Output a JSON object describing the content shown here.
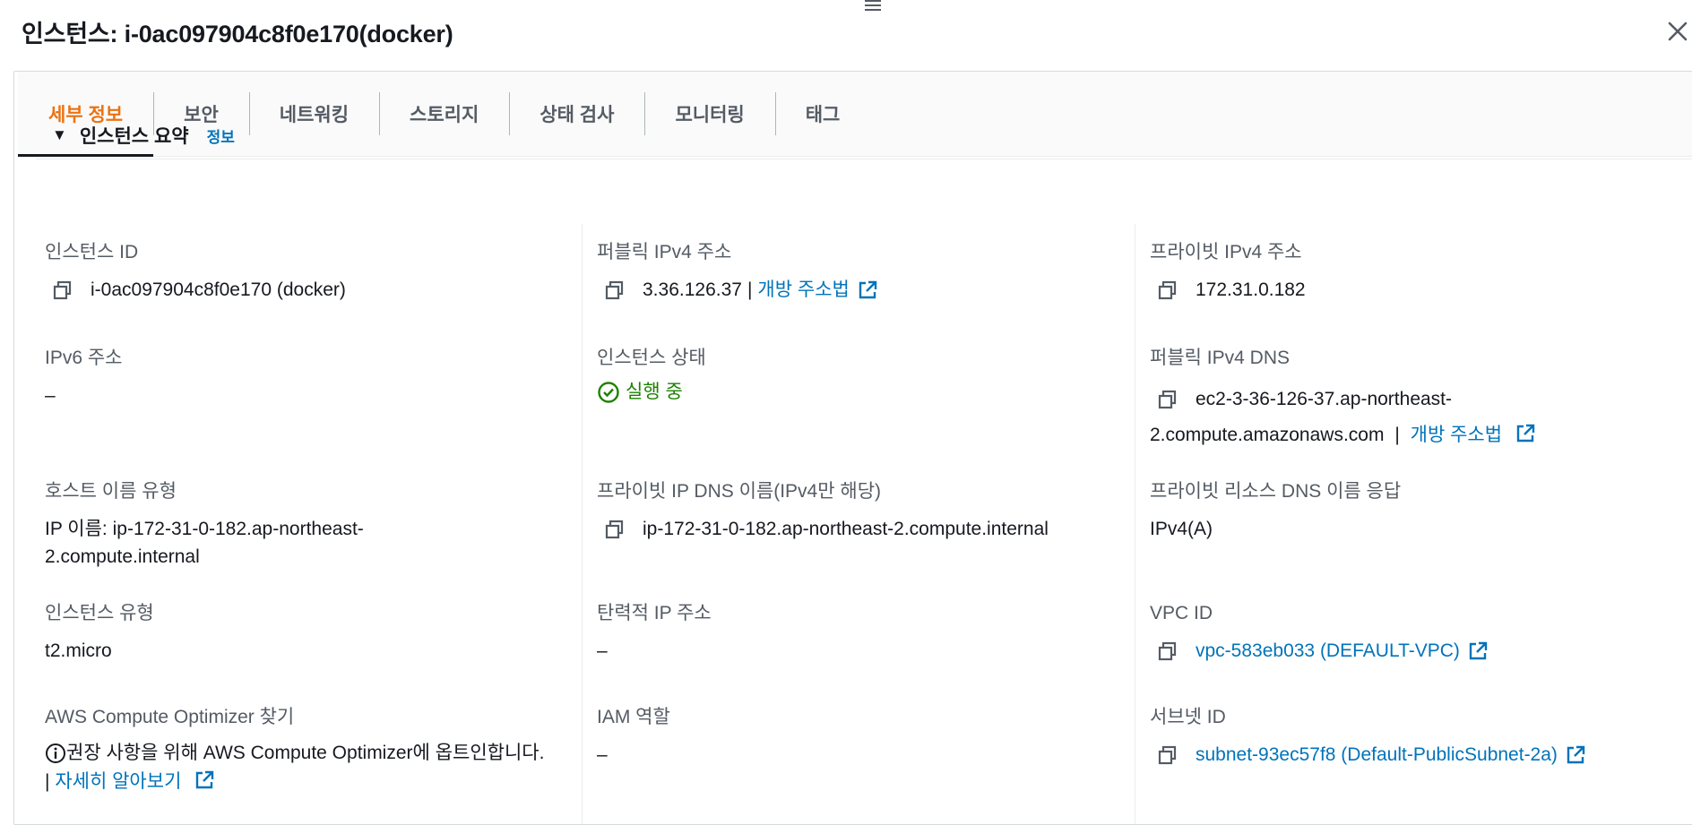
{
  "title": "인스턴스: i-0ac097904c8f0e170(docker)",
  "tabs": [
    "세부 정보",
    "보안",
    "네트워킹",
    "스토리지",
    "상태 검사",
    "모니터링",
    "태그"
  ],
  "summary": {
    "title": "인스턴스 요약",
    "info_link": "정보"
  },
  "fields": {
    "instance_id": {
      "label": "인스턴스 ID",
      "value": "i-0ac097904c8f0e170 (docker)"
    },
    "public_ipv4": {
      "label": "퍼블릭 IPv4 주소",
      "value": "3.36.126.37",
      "sep": "|",
      "link": "개방 주소법"
    },
    "private_ipv4": {
      "label": "프라이빗 IPv4 주소",
      "value": "172.31.0.182"
    },
    "ipv6": {
      "label": "IPv6 주소",
      "value": "–"
    },
    "instance_state": {
      "label": "인스턴스 상태",
      "value": "실행 중"
    },
    "public_dns": {
      "label": "퍼블릭 IPv4 DNS",
      "value_line1": "ec2-3-36-126-37.ap-northeast-",
      "value_line2": "2.compute.amazonaws.com",
      "sep": "|",
      "link": "개방 주소법"
    },
    "hostname_type": {
      "label": "호스트 이름 유형",
      "value_line1": "IP 이름: ip-172-31-0-182.ap-northeast-",
      "value_line2": "2.compute.internal"
    },
    "private_dns": {
      "label": "프라이빗 IP DNS 이름(IPv4만 해당)",
      "value": "ip-172-31-0-182.ap-northeast-2.compute.internal"
    },
    "private_resource_dns": {
      "label": "프라이빗 리소스 DNS 이름 응답",
      "value": "IPv4(A)"
    },
    "instance_type": {
      "label": "인스턴스 유형",
      "value": "t2.micro"
    },
    "elastic_ip": {
      "label": "탄력적 IP 주소",
      "value": "–"
    },
    "vpc_id": {
      "label": "VPC ID",
      "link": "vpc-583eb033 (DEFAULT-VPC)"
    },
    "compute_optimizer": {
      "label": "AWS Compute Optimizer 찾기",
      "value_line1": "권장 사항을 위해 AWS Compute Optimizer에 옵트인합니다.",
      "sep": "|",
      "link": "자세히 알아보기"
    },
    "iam_role": {
      "label": "IAM 역할",
      "value": "–"
    },
    "subnet_id": {
      "label": "서브넷 ID",
      "link": "subnet-93ec57f8 (Default-PublicSubnet-2a)"
    }
  },
  "colors": {
    "accent": "#ec7211",
    "link": "#0073bb",
    "success": "#1d8102",
    "text": "#16191f",
    "label": "#545b64"
  },
  "icons": [
    "close-icon",
    "copy-icon",
    "external-link-icon",
    "check-circle-icon",
    "info-icon",
    "caret-down-icon",
    "drag-handle-icon"
  ]
}
